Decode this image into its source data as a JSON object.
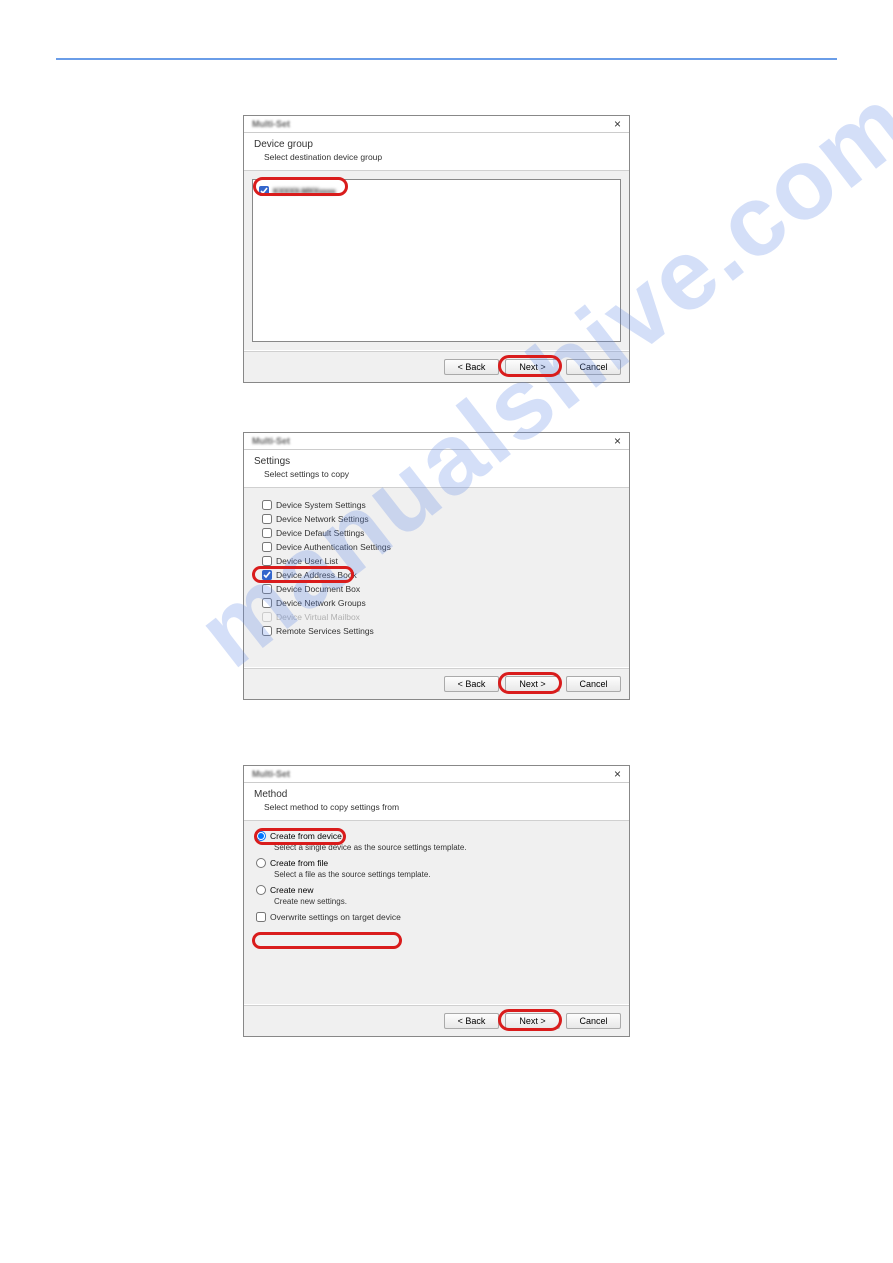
{
  "dialog1": {
    "window_title": "Multi-Set",
    "header_title": "Device group",
    "header_sub": "Select destination device group",
    "item_label": "KXXXX-MXXxxxx",
    "btn_back": "< Back",
    "btn_next": "Next >",
    "btn_cancel": "Cancel"
  },
  "dialog2": {
    "window_title": "Multi-Set",
    "header_title": "Settings",
    "header_sub": "Select settings to copy",
    "opt1": "Device System Settings",
    "opt2": "Device Network Settings",
    "opt3": "Device Default Settings",
    "opt4": "Device Authentication Settings",
    "opt5": "Device User List",
    "opt6": "Device Address Book",
    "opt7": "Device Document Box",
    "opt8": "Device Network Groups",
    "opt9": "Device Virtual Mailbox",
    "opt10": "Remote Services Settings",
    "btn_back": "< Back",
    "btn_next": "Next >",
    "btn_cancel": "Cancel"
  },
  "dialog3": {
    "window_title": "Multi-Set",
    "header_title": "Method",
    "header_sub": "Select method to copy settings from",
    "r1": "Create from device",
    "r1_sub": "Select a single device as the source settings template.",
    "r2": "Create from file",
    "r2_sub": "Select a file as the source settings template.",
    "r3": "Create new",
    "r3_sub": "Create new settings.",
    "overwrite": "Overwrite settings on target device",
    "btn_back": "< Back",
    "btn_next": "Next >",
    "btn_cancel": "Cancel"
  }
}
